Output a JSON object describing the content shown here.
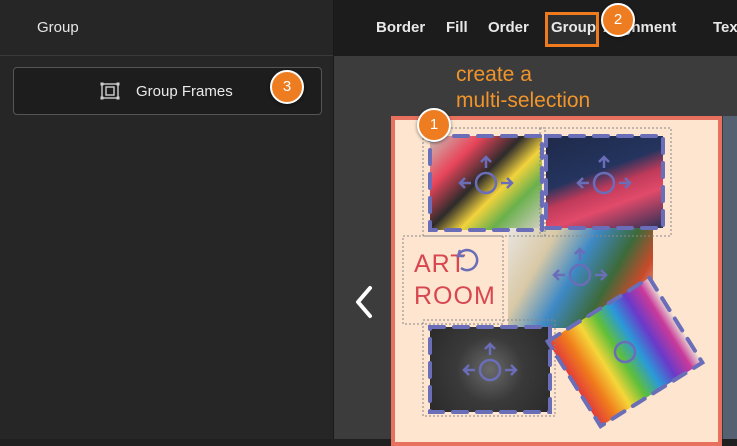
{
  "sidebar": {
    "title": "Group",
    "group_frames_label": "Group Frames",
    "group_frames_icon": "group-frames-icon"
  },
  "toolbar": {
    "tabs": [
      {
        "label": "Border"
      },
      {
        "label": "Fill"
      },
      {
        "label": "Order"
      },
      {
        "label": "Group"
      },
      {
        "label": "Alignment"
      },
      {
        "label": "Text"
      }
    ],
    "active_tab": "Group"
  },
  "canvas": {
    "annotation_text": "create a\nmulti-selection",
    "badges": [
      "1",
      "2",
      "3"
    ],
    "art_room_text_line1": "ART",
    "art_room_text_line2": "ROOM",
    "prev_icon": "chevron-left-icon"
  },
  "colors": {
    "accent_orange": "#ee7d22",
    "selection_blue": "#6a6db8",
    "page_bg": "#fde5cf",
    "page_border": "#e8705e"
  }
}
